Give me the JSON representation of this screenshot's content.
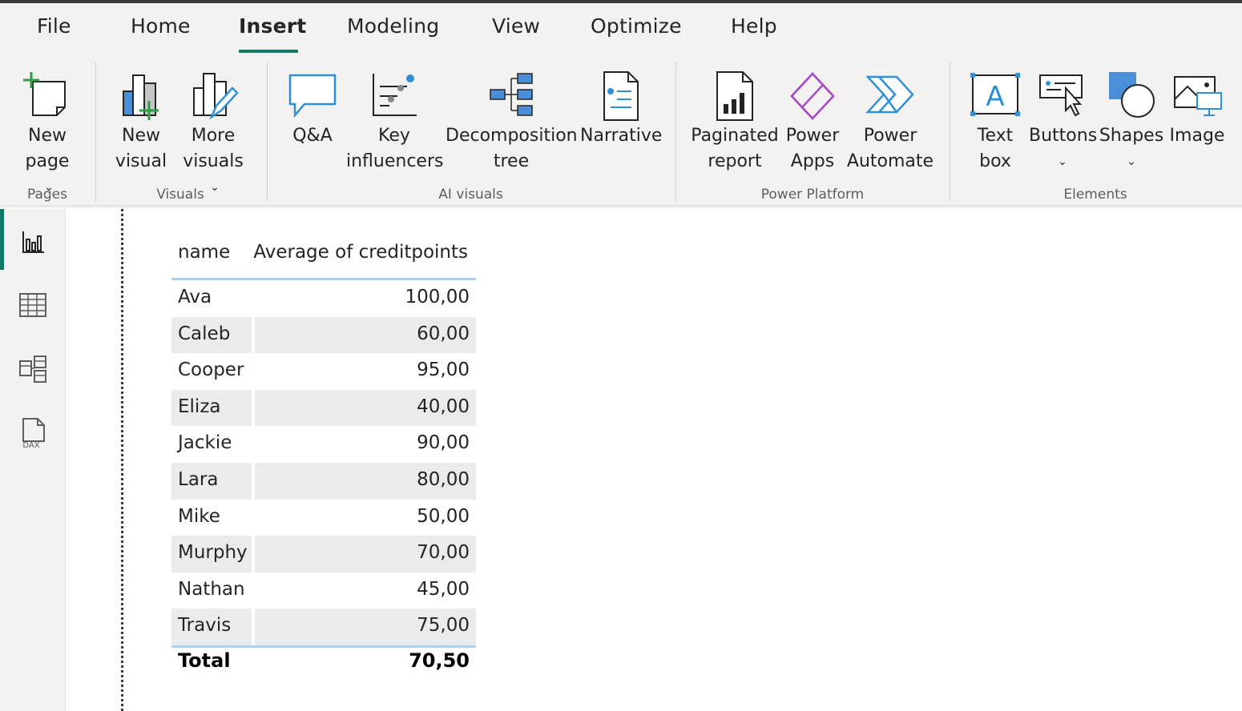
{
  "tabs": [
    {
      "label": "File"
    },
    {
      "label": "Home"
    },
    {
      "label": "Insert",
      "active": true
    },
    {
      "label": "Modeling"
    },
    {
      "label": "View"
    },
    {
      "label": "Optimize"
    },
    {
      "label": "Help"
    }
  ],
  "ribbon": {
    "pages": {
      "new_page": {
        "line1": "New",
        "line2": "page",
        "icon": "new-page-icon"
      },
      "group_label": "Pages"
    },
    "visuals": {
      "new_visual": {
        "line1": "New",
        "line2": "visual",
        "icon": "new-visual-icon"
      },
      "more_visuals": {
        "line1": "More",
        "line2": "visuals",
        "icon": "more-visuals-icon"
      },
      "group_label": "Visuals"
    },
    "ai_visuals": {
      "qa": {
        "line1": "Q&A",
        "icon": "qa-icon"
      },
      "key_influencers": {
        "line1": "Key",
        "line2": "influencers",
        "icon": "key-influencers-icon"
      },
      "decomposition_tree": {
        "line1": "Decomposition",
        "line2": "tree",
        "icon": "decomposition-tree-icon"
      },
      "narrative": {
        "line1": "Narrative",
        "icon": "narrative-icon"
      },
      "group_label": "AI visuals"
    },
    "power_platform": {
      "paginated_report": {
        "line1": "Paginated",
        "line2": "report",
        "icon": "paginated-report-icon"
      },
      "power_apps": {
        "line1": "Power",
        "line2": "Apps",
        "icon": "power-apps-icon"
      },
      "power_automate": {
        "line1": "Power",
        "line2": "Automate",
        "icon": "power-automate-icon"
      },
      "group_label": "Power Platform"
    },
    "elements": {
      "text_box": {
        "line1": "Text",
        "line2": "box",
        "icon": "text-box-icon"
      },
      "buttons": {
        "line1": "Buttons",
        "icon": "buttons-icon"
      },
      "shapes": {
        "line1": "Shapes",
        "icon": "shapes-icon"
      },
      "image": {
        "line1": "Image",
        "icon": "image-icon"
      },
      "group_label": "Elements"
    }
  },
  "rail": {
    "report": {
      "icon": "report-view-icon",
      "active": true
    },
    "table": {
      "icon": "table-view-icon"
    },
    "model": {
      "icon": "model-view-icon"
    },
    "dax": {
      "icon": "dax-query-view-icon",
      "text": "DAX"
    }
  },
  "table": {
    "headers": [
      "name",
      "Average of creditpoints"
    ],
    "rows": [
      {
        "name": "Ava",
        "value": "100,00"
      },
      {
        "name": "Caleb",
        "value": "60,00"
      },
      {
        "name": "Cooper",
        "value": "95,00"
      },
      {
        "name": "Eliza",
        "value": "40,00"
      },
      {
        "name": "Jackie",
        "value": "90,00"
      },
      {
        "name": "Lara",
        "value": "80,00"
      },
      {
        "name": "Mike",
        "value": "50,00"
      },
      {
        "name": "Murphy",
        "value": "70,00"
      },
      {
        "name": "Nathan",
        "value": "45,00"
      },
      {
        "name": "Travis",
        "value": "75,00"
      }
    ],
    "total": {
      "label": "Total",
      "value": "70,50"
    }
  },
  "colors": {
    "accent": "#117865",
    "header_rule": "#a9d1f0",
    "power_apps": "#a74ac7",
    "blue_icon": "#2f8fd8"
  }
}
